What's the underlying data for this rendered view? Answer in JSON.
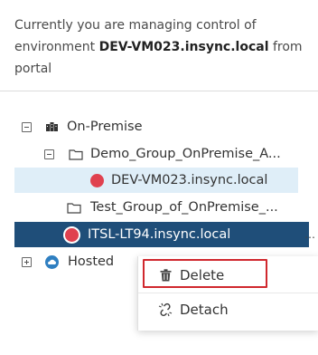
{
  "notice": {
    "prefix": "Currently you are managing control of environment ",
    "environment": "DEV-VM023.insync.local",
    "suffix": " from portal"
  },
  "tree": {
    "on_premise": "On-Premise",
    "demo_group": "Demo_Group_OnPremise_A...",
    "dev_vm": "DEV-VM023.insync.local",
    "test_group": "Test_Group_of_OnPremise_...",
    "itsl": "ITSL-LT94.insync.local",
    "hosted": "Hosted"
  },
  "context_menu": {
    "delete": "Delete",
    "detach": "Detach"
  },
  "colors": {
    "status_offline": "#e0414f",
    "selected_dark": "#1f4e79",
    "selected_light": "#dfeef8",
    "highlight_border": "#d0282e"
  }
}
